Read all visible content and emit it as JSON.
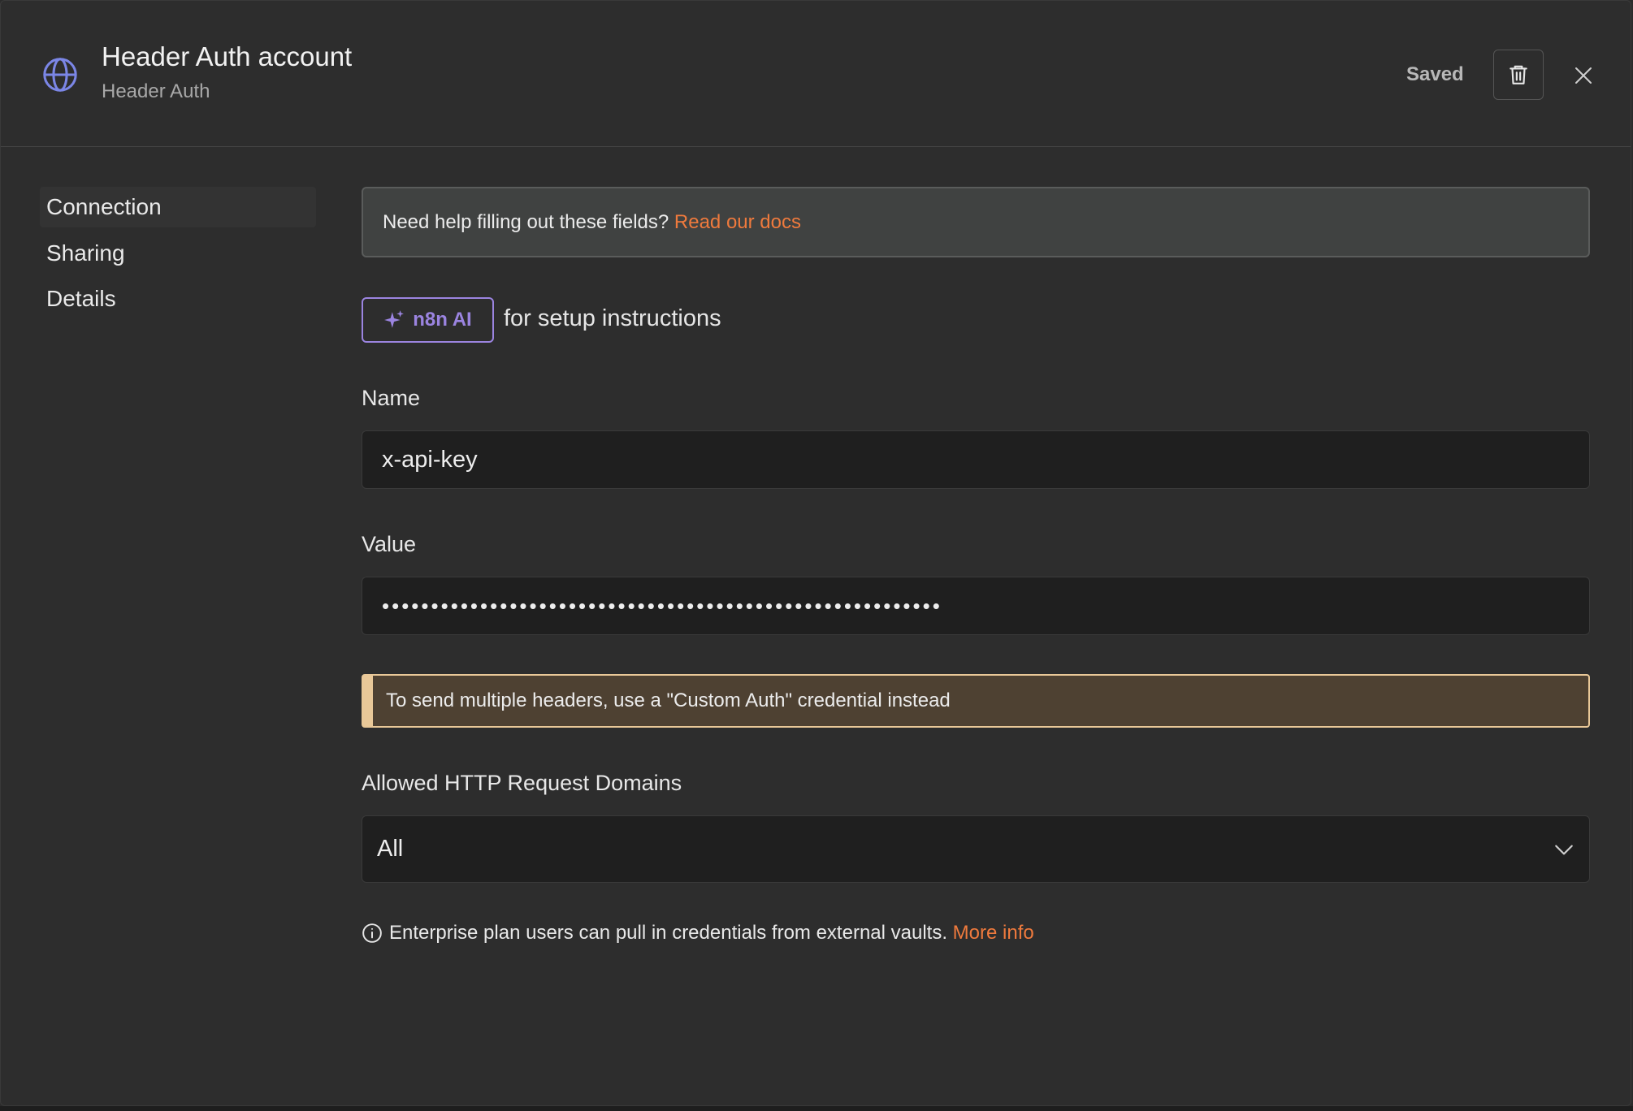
{
  "header": {
    "title": "Header Auth account",
    "subtitle": "Header Auth",
    "status": "Saved",
    "icon": "globe-icon"
  },
  "sidebar": {
    "items": [
      {
        "label": "Connection",
        "active": true
      },
      {
        "label": "Sharing",
        "active": false
      },
      {
        "label": "Details",
        "active": false
      }
    ]
  },
  "help": {
    "text": "Need help filling out these fields? ",
    "link": "Read our docs"
  },
  "ai": {
    "button_label": "n8n AI",
    "text": "for setup instructions"
  },
  "form": {
    "name_label": "Name",
    "name_value": "x-api-key",
    "value_label": "Value",
    "value_masked": "•••••••••••••••••••••••••••••••••••••••••••••••••••••••••",
    "warning": "To send multiple headers, use a \"Custom Auth\" credential instead",
    "domains_label": "Allowed HTTP Request Domains",
    "domains_value": "All"
  },
  "footer": {
    "info_text": "Enterprise plan users can pull in credentials from external vaults. ",
    "info_link": "More info"
  },
  "colors": {
    "accent_link": "#ef7a3d",
    "ai_purple": "#9b84e0",
    "globe_blue": "#7b86e6",
    "warning_border": "#e9c898",
    "warning_bg": "#4e4132"
  }
}
